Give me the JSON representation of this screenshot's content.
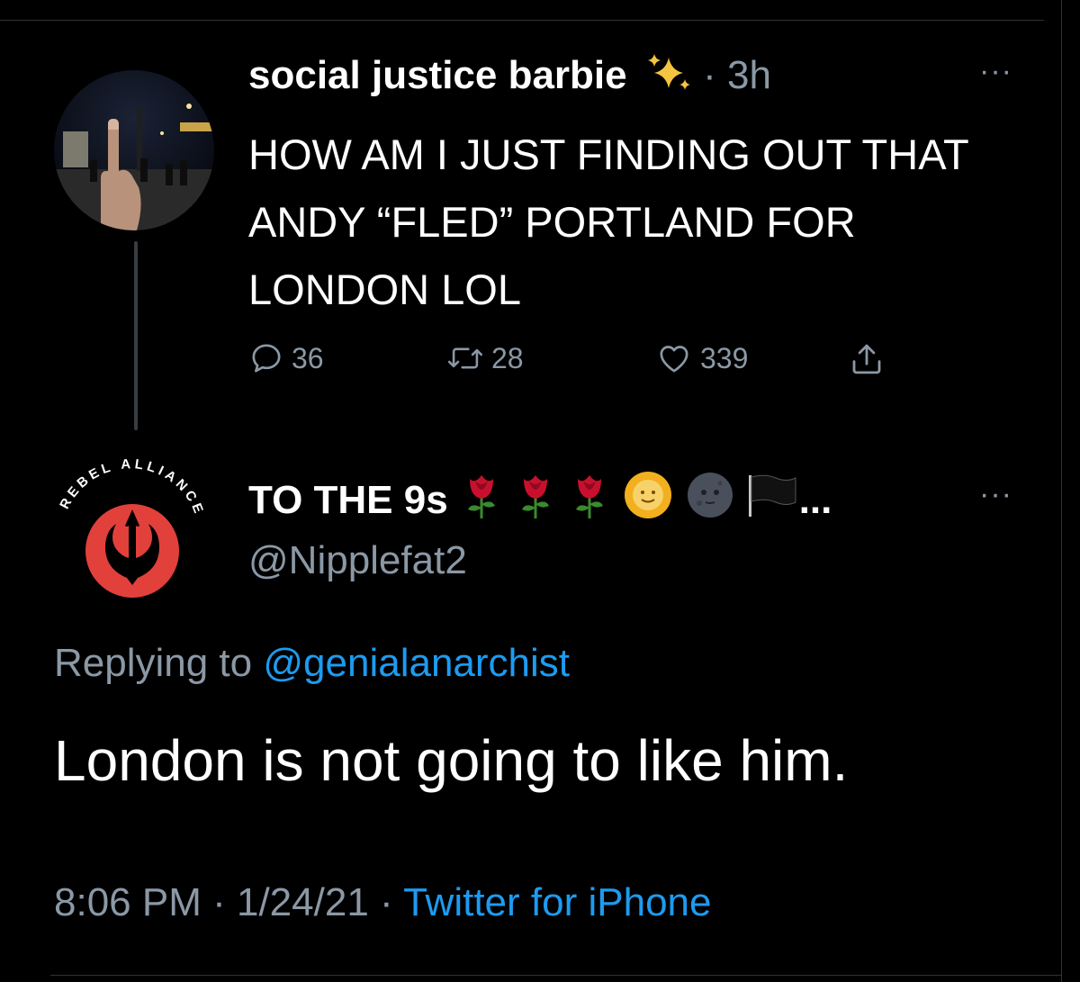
{
  "tweet1": {
    "name": "social justice barbie",
    "separator": " · ",
    "time": "3h",
    "more": "···",
    "text": "HOW AM I JUST FINDING OUT THAT ANDY “FLED” PORTLAND FOR LONDON LOL",
    "replies": "36",
    "retweets": "28",
    "likes": "339"
  },
  "tweet2": {
    "name": "TO THE 9s",
    "name_emojis": [
      "rose",
      "rose",
      "rose",
      "sun-with-face",
      "new-moon-face",
      "black-flag"
    ],
    "name_ellipsis": "...",
    "handle": "@Nipplefat2",
    "more": "···",
    "avatar_text": "REBEL ALLIANCE",
    "replying_prefix": "Replying to",
    "replying_to": "@genialanarchist",
    "text": "London is not going to like him.",
    "time": "8:06 PM",
    "date": "1/24/21",
    "source": "Twitter for iPhone",
    "sep": " · "
  },
  "colors": {
    "background": "#000000",
    "muted": "#8b98a5",
    "link": "#1d9bf0",
    "rebel_red": "#e2403b"
  }
}
